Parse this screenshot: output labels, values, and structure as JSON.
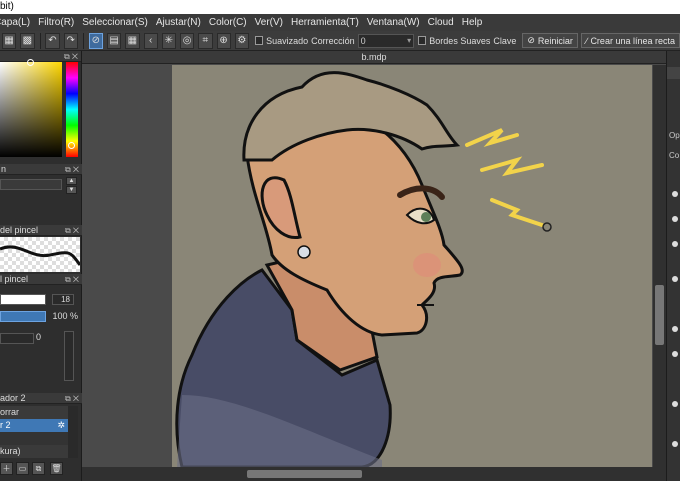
{
  "window": {
    "title": "bit)"
  },
  "menu": [
    "Capa(L)",
    "Filtro(R)",
    "Seleccionar(S)",
    "Ajustar(N)",
    "Color(C)",
    "Ver(V)",
    "Herramienta(T)",
    "Ventana(W)",
    "Cloud",
    "Help"
  ],
  "toolbar": {
    "smooth_label": "Suavizado",
    "correction_label": "Corrección",
    "correction_value": "0",
    "soft_edges_label": "Bordes Suaves",
    "key_label": "Clave",
    "reset_label": "Reiniciar",
    "straight_line_label": "Crear una línea recta"
  },
  "panels": {
    "brush_shape_title": "del pincel",
    "brush_size_title": "l pincel",
    "brush_size_value": "18",
    "opacity_value": "100 %",
    "stabilizer_value": "0",
    "layers_title": "ador 2",
    "layer_erase": "orrar",
    "layer_active": "r 2",
    "layer_kura": "kura)"
  },
  "document": {
    "tab_title": "b.mdp"
  },
  "right_panel": {
    "labels": [
      "Op",
      "Co"
    ]
  },
  "colors": {
    "accent": "#3f78b5",
    "canvas_bg": "#8a8677",
    "hair": "#a89a82",
    "skin": "#d4a077",
    "hoodie": "#484c66",
    "lightning": "#f2d34a"
  },
  "icons": [
    "undo-icon",
    "redo-icon",
    "lasso-icon",
    "select-icon",
    "wand-icon",
    "brush-icon",
    "reset-icon",
    "line-icon"
  ]
}
